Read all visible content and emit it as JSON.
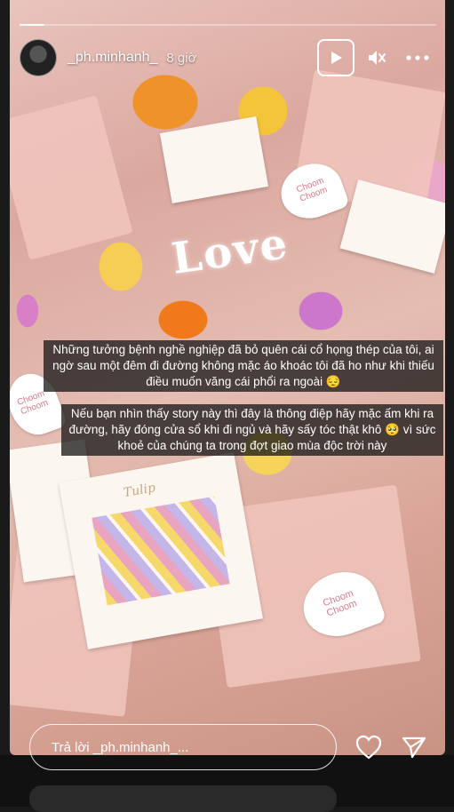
{
  "story": {
    "progress": 0.06,
    "love_text": "Love",
    "tag_text": "Choom Choom",
    "card_title": "Tulip"
  },
  "header": {
    "username": "_ph.minhanh_",
    "time": "8 giờ",
    "play_icon": "play-icon",
    "mute_icon": "mute-icon",
    "more_icon": "more-icon"
  },
  "captions": [
    "Những tưởng bệnh nghề nghiệp đã bỏ quên cái cổ họng thép của tôi, ai ngờ sau một đêm đi đường không mặc áo khoác tôi đã ho như khi thiếu điều muốn văng cái phổi ra ngoài 😔",
    "Nếu bạn nhìn thấy story này thì đây là thông điệp hãy mặc ấm khi ra đường, hãy đóng cửa sổ khi đi ngủ và hãy sấy tóc thật khô 🥺 vì sức khoẻ của chúng ta trong đợt giao mùa độc trời này"
  ],
  "footer": {
    "reply_placeholder": "Trả lời _ph.minhanh_...",
    "like_icon": "heart-icon",
    "send_icon": "send-icon"
  }
}
